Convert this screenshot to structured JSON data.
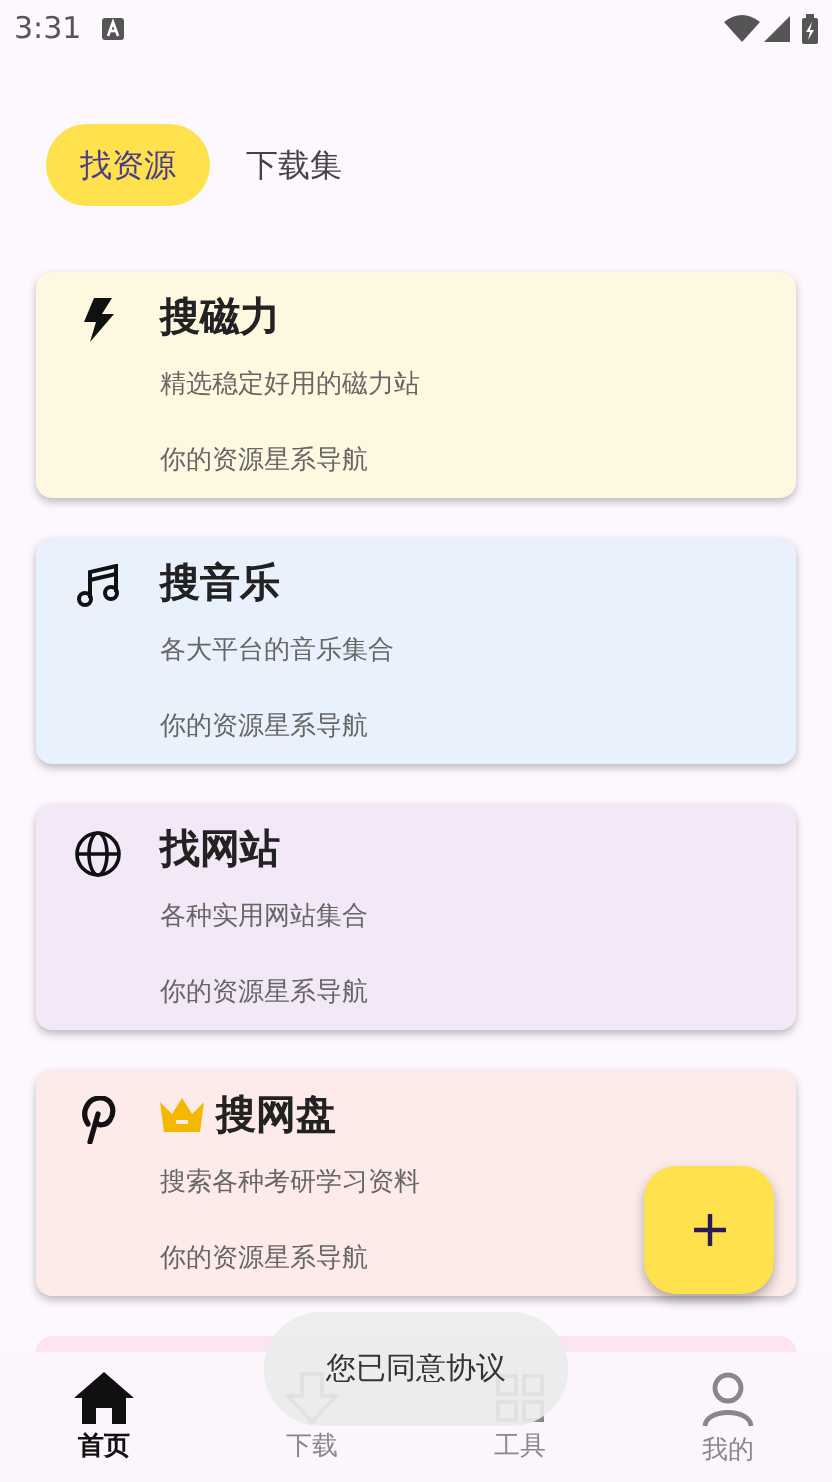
{
  "status_bar": {
    "time": "3:31"
  },
  "tabs": [
    {
      "label": "找资源",
      "selected": true
    },
    {
      "label": "下载集",
      "selected": false
    }
  ],
  "cards": [
    {
      "title": "搜磁力",
      "subtitle": "精选稳定好用的磁力站",
      "footer": "你的资源星系导航",
      "color": "#fff8e1",
      "premium": false
    },
    {
      "title": "搜音乐",
      "subtitle": "各大平台的音乐集合",
      "footer": "你的资源星系导航",
      "color": "#e9f1fc",
      "premium": false
    },
    {
      "title": "找网站",
      "subtitle": "各种实用网站集合",
      "footer": "你的资源星系导航",
      "color": "#f2e8f7",
      "premium": false
    },
    {
      "title": "搜网盘",
      "subtitle": "搜索各种考研学习资料",
      "footer": "你的资源星系导航",
      "color": "#fdebe9",
      "premium": true
    },
    {
      "color": "#fce4f1"
    }
  ],
  "toast": "您已同意协议",
  "nav": [
    {
      "label": "首页",
      "selected": true
    },
    {
      "label": "下载",
      "selected": false
    },
    {
      "label": "工具",
      "selected": false
    },
    {
      "label": "我的",
      "selected": false
    }
  ]
}
